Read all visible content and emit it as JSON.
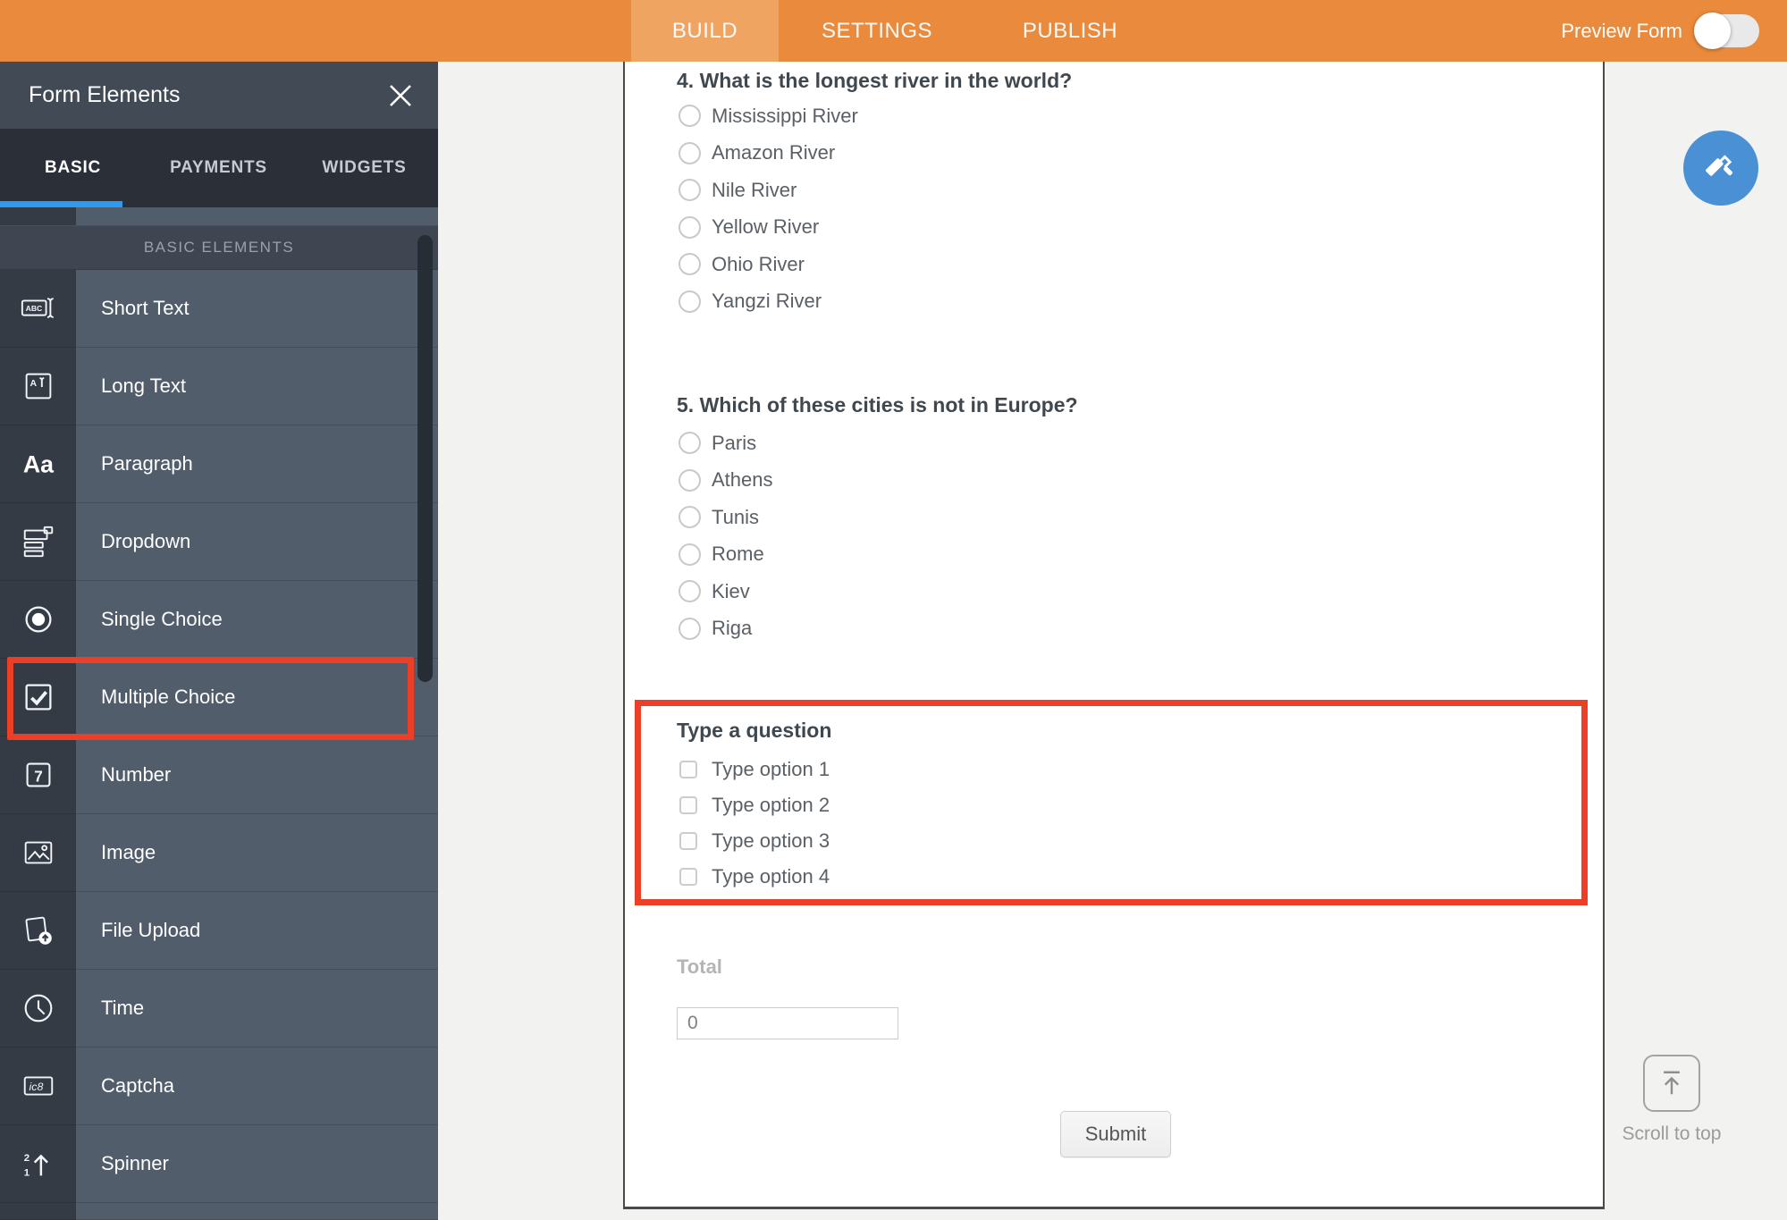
{
  "header": {
    "tabs": [
      {
        "label": "BUILD",
        "active": true
      },
      {
        "label": "SETTINGS",
        "active": false
      },
      {
        "label": "PUBLISH",
        "active": false
      }
    ],
    "preview_label": "Preview Form",
    "preview_toggle_state": "off"
  },
  "panel": {
    "title": "Form Elements",
    "tabs": [
      "BASIC",
      "PAYMENTS",
      "WIDGETS"
    ],
    "active_tab": "BASIC",
    "section_header": "BASIC ELEMENTS",
    "items": [
      {
        "label": "Short Text",
        "icon": "short-text-icon"
      },
      {
        "label": "Long Text",
        "icon": "long-text-icon"
      },
      {
        "label": "Paragraph",
        "icon": "paragraph-icon"
      },
      {
        "label": "Dropdown",
        "icon": "dropdown-icon"
      },
      {
        "label": "Single Choice",
        "icon": "single-choice-icon"
      },
      {
        "label": "Multiple Choice",
        "icon": "multiple-choice-icon"
      },
      {
        "label": "Number",
        "icon": "number-icon"
      },
      {
        "label": "Image",
        "icon": "image-icon"
      },
      {
        "label": "File Upload",
        "icon": "file-upload-icon"
      },
      {
        "label": "Time",
        "icon": "time-icon"
      },
      {
        "label": "Captcha",
        "icon": "captcha-icon"
      },
      {
        "label": "Spinner",
        "icon": "spinner-icon"
      }
    ],
    "highlighted_item": "Multiple Choice"
  },
  "form": {
    "questions": [
      {
        "title": "4. What is the longest river in the world?",
        "type": "radio",
        "options": [
          "Mississippi River",
          "Amazon River",
          "Nile River",
          "Yellow River",
          "Ohio River",
          "Yangzi River"
        ]
      },
      {
        "title": "5. Which of these cities is not in Europe?",
        "type": "radio",
        "options": [
          "Paris",
          "Athens",
          "Tunis",
          "Rome",
          "Kiev",
          "Riga"
        ]
      },
      {
        "title": "Type a question",
        "type": "checkbox",
        "highlighted": true,
        "options": [
          "Type option 1",
          "Type option 2",
          "Type option 3",
          "Type option 4"
        ]
      }
    ],
    "total": {
      "label": "Total",
      "value": "0"
    },
    "submit_label": "Submit"
  },
  "floating": {
    "scroll_to_top_label": "Scroll to top"
  },
  "colors": {
    "header_orange": "#e98a3c",
    "active_tab_orange": "#efa462",
    "highlight_red": "#ec3f27",
    "tab_underline_blue": "#2e9bf0",
    "designer_blue": "#4a90d5",
    "sidebar_row": "#515d6b",
    "sidebar_icon_column": "#343b45"
  }
}
